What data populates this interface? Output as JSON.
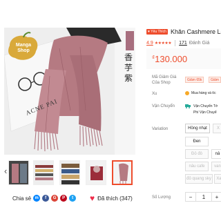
{
  "product": {
    "title": "Khăn Cashmere Lo",
    "favorite_badge": "♥ Yêu Thích",
    "rating": "4.9",
    "stars": "★★★★★",
    "review_count": "171",
    "review_label": "Đánh Giá",
    "currency": "₫",
    "price": "130.000"
  },
  "image": {
    "watermark_line1": "Manga",
    "watermark_line2": "Shop",
    "vertical_text": "香芋紫",
    "brand_text": "ACNE PAI"
  },
  "info": {
    "voucher_label": "Mã Giảm Giá Của Shop",
    "vouchers": [
      "Giảm 65k",
      "Giảm"
    ],
    "xu_label": "Xu",
    "xu_text": "Mua hàng và tíc",
    "shipping_label": "Vận Chuyển",
    "shipping_line1": "Vận Chuyển Tớ",
    "shipping_line2": "Phí Vận Chuyể",
    "variation_label": "Variation",
    "quantity_label": "Số Lượng"
  },
  "variations": [
    {
      "label": "Hồng nhạt",
      "disabled": false
    },
    {
      "label": "X",
      "disabled": true
    },
    {
      "label": "Đen",
      "disabled": false
    },
    {
      "label": "Đỏ đô",
      "disabled": true
    },
    {
      "label": "nâ",
      "disabled": false
    },
    {
      "label": "nâu cafe",
      "disabled": true
    },
    {
      "label": "van",
      "disabled": true
    },
    {
      "label": "đỏ quang sky",
      "disabled": true
    },
    {
      "label": "Xa",
      "disabled": true
    }
  ],
  "quantity": {
    "minus": "−",
    "value": "1",
    "plus": "+"
  },
  "share": {
    "label": "Chia sẻ",
    "icons": [
      "messenger-icon",
      "facebook-icon",
      "google-plus-icon",
      "pinterest-icon",
      "twitter-icon"
    ]
  },
  "likes": {
    "label": "Đã thích (347)"
  },
  "colors": {
    "accent": "#ee4d2d",
    "scarf": "#b57a82"
  }
}
